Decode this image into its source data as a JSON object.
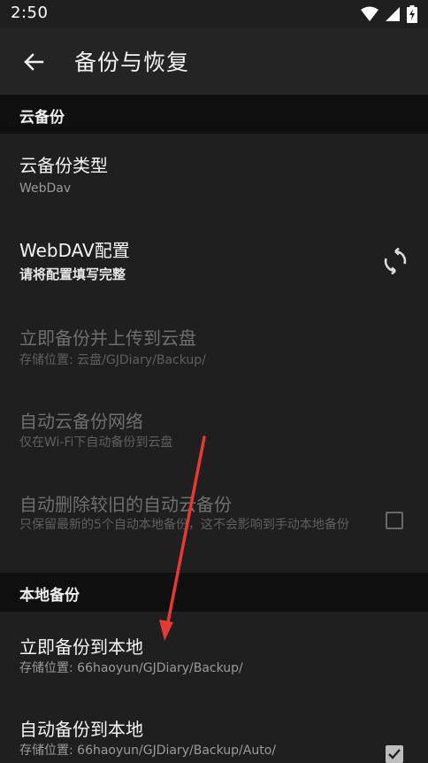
{
  "status_bar": {
    "time": "2:50"
  },
  "toolbar": {
    "title": "备份与恢复"
  },
  "sections": {
    "cloud": "云备份",
    "local": "本地备份"
  },
  "cloud_prefs": {
    "type_title": "云备份类型",
    "type_summary": "WebDav",
    "webdav_title": "WebDAV配置",
    "webdav_summary": "请将配置填写完整",
    "backup_now_title": "立即备份并上传到云盘",
    "backup_now_summary": "存储位置: 云盘/GJDiary/Backup/",
    "auto_network_title": "自动云备份网络",
    "auto_network_summary": "仅在Wi-Fi下自动备份到云盘",
    "auto_delete_title": "自动删除较旧的自动云备份",
    "auto_delete_summary": "只保留最新的5个自动本地备份，这不会影响到手动本地备份"
  },
  "local_prefs": {
    "backup_now_title": "立即备份到本地",
    "backup_now_summary": "存储位置: 66haoyun/GJDiary/Backup/",
    "auto_backup_title": "自动备份到本地",
    "auto_backup_summary": "存储位置: 66haoyun/GJDiary/Backup/Auto/"
  },
  "colors": {
    "background": "#1f1f1f",
    "section_header": "#0f0f0f",
    "annotation_arrow": "#e53935"
  }
}
